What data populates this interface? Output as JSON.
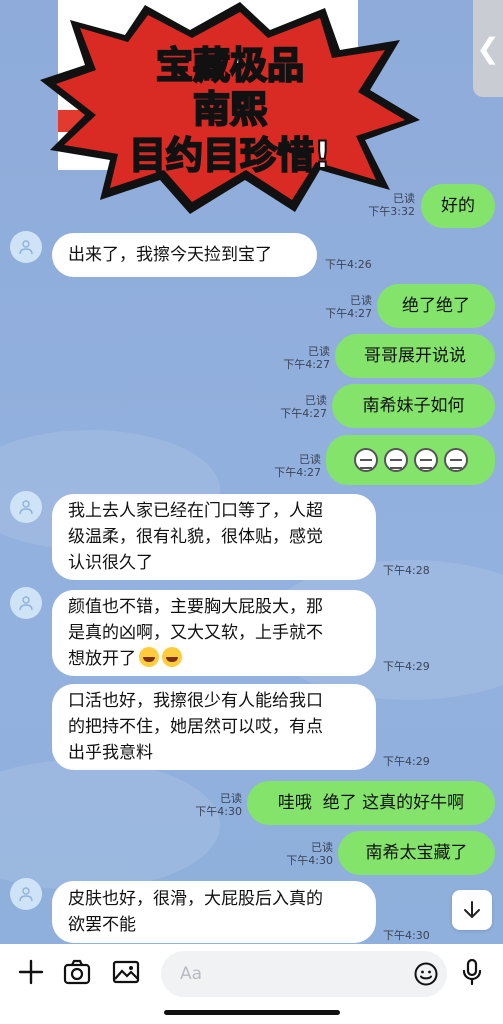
{
  "banner": {
    "line1": "宝藏极品",
    "line2": "南熙",
    "line3": "目约目珍惜!"
  },
  "side_handle": {
    "label": "❮"
  },
  "messages": [
    {
      "text": "好的",
      "status": "已读",
      "time": "下午3:32"
    },
    {
      "text": "出来了，我擦今天捡到宝了",
      "time": "下午4:26"
    },
    {
      "text": "绝了绝了",
      "status": "已读",
      "time": "下午4:27"
    },
    {
      "text": "哥哥展开说说",
      "status": "已读",
      "time": "下午4:27"
    },
    {
      "text": "南希妹子如何",
      "status": "已读",
      "time": "下午4:27"
    },
    {
      "text": "",
      "status": "已读",
      "time": "下午4:27"
    },
    {
      "line1": "我上去人家已经在门口等了，人超",
      "line2": "级温柔，很有礼貌，很体贴，感觉",
      "line3": "认识很久了",
      "time": "下午4:28"
    },
    {
      "line1": "颜值也不错，主要胸大屁股大，那",
      "line2": "是真的凶啊，又大又软，上手就不",
      "line3": "想放开了",
      "time": "下午4:29"
    },
    {
      "line1": "口活也好，我擦很少有人能给我口",
      "line2": "的把持不住，她居然可以哎，有点",
      "line3": "出乎我意料",
      "time": "下午4:29"
    },
    {
      "text": "哇哦  绝了 这真的好牛啊",
      "status": "已读",
      "time": "下午4:30"
    },
    {
      "text": "南希太宝藏了",
      "status": "已读",
      "time": "下午4:30"
    },
    {
      "line1": "皮肤也好，很滑，大屁股后入真的",
      "line2": "欲罢不能",
      "time": "下午4:30"
    }
  ],
  "input": {
    "placeholder": "Aa"
  },
  "icons": {
    "plus": "plus-icon",
    "camera": "camera-icon",
    "image": "image-icon",
    "emoji": "emoji-icon",
    "mic": "microphone-icon",
    "scroll": "arrow-down-icon"
  },
  "colors": {
    "sent_bubble": "#84e36b",
    "received_bubble": "#ffffff",
    "background": "#8faedc"
  }
}
